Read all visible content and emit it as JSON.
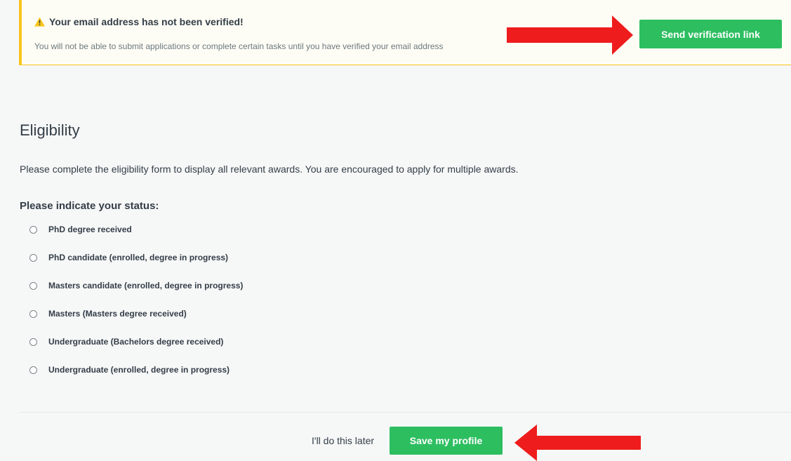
{
  "alert": {
    "title": "Your email address has not been verified!",
    "message": "You will not be able to submit applications or complete certain tasks until you have verified your email address",
    "button_label": "Send verification link",
    "icon": "warning-icon"
  },
  "eligibility": {
    "heading": "Eligibility",
    "intro": "Please complete the eligibility form to display all relevant awards. You are encouraged to apply for multiple awards.",
    "status_label": "Please indicate your status:",
    "options": [
      {
        "label": "PhD degree received",
        "selected": false
      },
      {
        "label": "PhD candidate (enrolled, degree in progress)",
        "selected": false
      },
      {
        "label": "Masters candidate (enrolled, degree in progress)",
        "selected": false
      },
      {
        "label": "Masters (Masters degree received)",
        "selected": false
      },
      {
        "label": "Undergraduate (Bachelors degree received)",
        "selected": false
      },
      {
        "label": "Undergraduate (enrolled, degree in progress)",
        "selected": false
      }
    ]
  },
  "footer": {
    "later_label": "I'll do this later",
    "save_label": "Save my profile"
  },
  "colors": {
    "accent_green": "#2dbe60",
    "warning_yellow": "#f8c51c",
    "arrow_red": "#ee1c1c"
  }
}
